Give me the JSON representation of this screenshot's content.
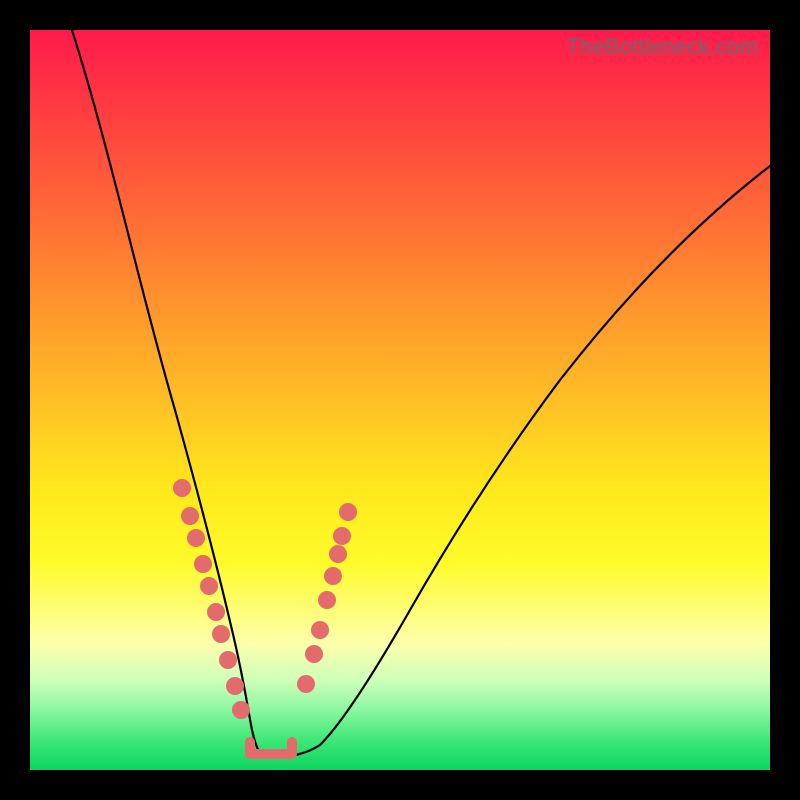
{
  "header": {
    "watermark_text": "TheBottleneck.com"
  },
  "domain": "Chart",
  "chart_data": {
    "type": "line",
    "title": "",
    "xlabel": "",
    "ylabel": "",
    "xlim": [
      0,
      100
    ],
    "ylim": [
      0,
      100
    ],
    "grid": false,
    "series": [
      {
        "name": "bottleneck-curve",
        "x": [
          5,
          8,
          12,
          16,
          19,
          21.5,
          23.5,
          25,
          26.5,
          28,
          29.2,
          30,
          31,
          32.5,
          34,
          36,
          38,
          41,
          45,
          50,
          56,
          63,
          72,
          82,
          92,
          100
        ],
        "y": [
          100,
          83,
          66,
          51,
          41,
          33,
          27,
          22,
          17,
          12,
          8,
          6,
          4,
          3.2,
          3.4,
          4.5,
          7.5,
          12,
          19,
          27,
          36,
          45,
          56,
          66,
          75,
          82
        ],
        "note": "Values estimated from pixel positions; chart has no axes/ticks so precision is coarse."
      }
    ],
    "markers": {
      "left_cluster": {
        "x_range": [
          19,
          28
        ],
        "y_range": [
          9,
          38
        ],
        "count_approx": 10
      },
      "right_cluster": {
        "x_range": [
          35,
          42
        ],
        "y_range": [
          5,
          35
        ],
        "count_approx": 8
      },
      "bottom_bracket": {
        "x_range": [
          28,
          34
        ],
        "y_approx": 3
      }
    },
    "background_gradient": {
      "direction": "top-to-bottom",
      "stops": [
        {
          "pos": 0.0,
          "color": "#ff1a4d"
        },
        {
          "pos": 0.35,
          "color": "#ff8d2e"
        },
        {
          "pos": 0.62,
          "color": "#ffe81c"
        },
        {
          "pos": 0.88,
          "color": "#ccffb8"
        },
        {
          "pos": 1.0,
          "color": "#0cd45f"
        }
      ]
    }
  }
}
